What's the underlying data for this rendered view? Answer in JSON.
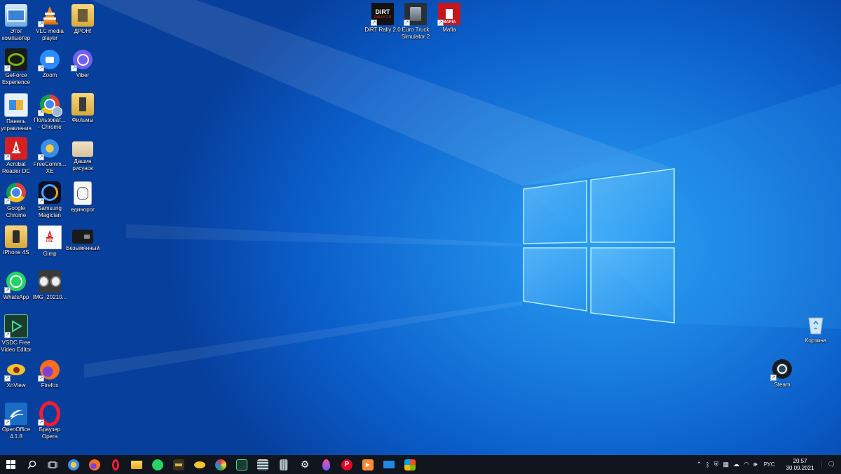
{
  "desktop_icons": {
    "this_pc": "Этот\nкомпьютер",
    "vlc": "VLC media\nplayer",
    "drone": "ДРОН!",
    "geforce": "GeForce\nExperience",
    "zoom": "Zoom",
    "viber": "Viber",
    "control_panel": "Панель\nуправления",
    "chrome_user": "Пользоват...\n- Chrome",
    "films": "Фильмы",
    "acrobat": "Acrobat\nReader DC",
    "freecommander": "FreeComm...\nXE",
    "dashin": "Дашин\nрисунок",
    "google_chrome": "Google\nChrome",
    "samsung_magician": "Samsung\nMagician",
    "unicorn": "единорог",
    "iphone": "iPhone 4S",
    "gimp": "Gimp",
    "untitled": "Безымянный",
    "whatsapp": "WhatsApp",
    "img": "IMG_20210...",
    "vsdc": "VSDC Free\nVideo Editor",
    "xnview": "XnView",
    "firefox": "Firefox",
    "openoffice": "OpenOffice\n4.1.8",
    "opera": "Браузер\nOpera",
    "dirt": "DiRT Rally 2.0",
    "euro_truck": "Euro Truck\nSimulator 2",
    "mafia": "Mafia",
    "recycle_bin": "Корзина",
    "steam": "Steam"
  },
  "icon_glyphs": {
    "dirt_tile": "DiRT",
    "dirt_sub": "RALLY 2.0",
    "mafia_tile": "MAFIA",
    "pdf_tile": "PDF"
  },
  "tray": {
    "language": "РУС",
    "time": "20:57",
    "date": "30.09.2021"
  },
  "colors": {
    "desktop_bg": "#0a5cc8",
    "taskbar_bg": "#10151e"
  }
}
